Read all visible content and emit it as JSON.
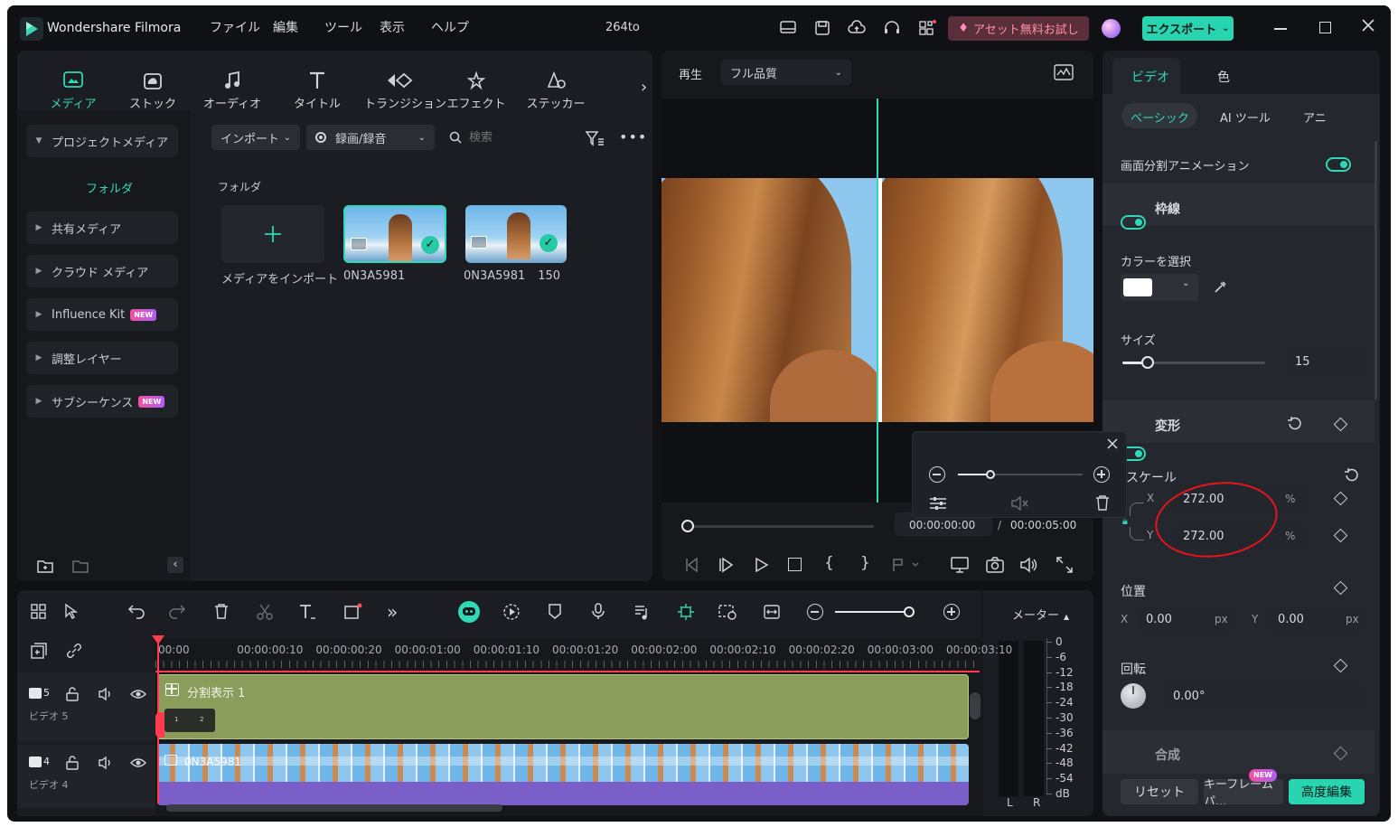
{
  "app": {
    "logo_text": "Wondershare Filmora",
    "menu": [
      "ファイル",
      "編集",
      "ツール",
      "表示",
      "ヘルプ"
    ],
    "project_name": "264to",
    "asset_promo": "アセット無料お試し",
    "export_label": "エクスポート"
  },
  "media_tabs": [
    {
      "label": "メディア",
      "icon": "media-icon",
      "active": true
    },
    {
      "label": "ストック",
      "icon": "stock-icon"
    },
    {
      "label": "オーディオ",
      "icon": "audio-icon"
    },
    {
      "label": "タイトル",
      "icon": "title-icon"
    },
    {
      "label": "トランジション",
      "icon": "transition-icon"
    },
    {
      "label": "エフェクト",
      "icon": "effect-icon"
    },
    {
      "label": "ステッカー",
      "icon": "sticker-icon"
    }
  ],
  "sidebar": {
    "project_media": "プロジェクトメディア",
    "folder": "フォルダ",
    "items": [
      {
        "label": "共有メディア"
      },
      {
        "label": "クラウド メディア"
      },
      {
        "label": "Influence Kit",
        "badge": "NEW"
      },
      {
        "label": "調整レイヤー"
      },
      {
        "label": "サブシーケンス",
        "badge": "NEW"
      }
    ]
  },
  "media_toolbar": {
    "import": "インポート",
    "record": "録画/録音",
    "search_placeholder": "検索"
  },
  "media_grid": {
    "folder_label": "フォルダ",
    "import_tile": "メディアをインポート",
    "items": [
      {
        "name": "0N3A5981"
      },
      {
        "name": "0N3A5981",
        "suffix": "150"
      }
    ]
  },
  "preview": {
    "play_label": "再生",
    "quality": "フル品質",
    "time_current": "00:00:00:00",
    "time_separator": "/",
    "time_total": "00:00:05:00"
  },
  "right_panel": {
    "tabs": [
      "ビデオ",
      "色"
    ],
    "subtabs": [
      "ベーシック",
      "AI ツール",
      "アニ"
    ],
    "split_anim": "画面分割アニメーション",
    "border": "枠線",
    "color_label": "カラーを選択",
    "color_value": "#ffffff",
    "size_label": "サイズ",
    "size_value": "15",
    "size_fraction": 0.18,
    "transform": "変形",
    "scale": "スケール",
    "scale_x": "272.00",
    "scale_y": "272.00",
    "axis_x": "X",
    "axis_y": "Y",
    "percent": "%",
    "position": "位置",
    "pos_x": "0.00",
    "pos_y": "0.00",
    "px": "px",
    "rotation": "回転",
    "rotation_value": "0.00°",
    "composite": "合成",
    "reset": "リセット",
    "keyframe": "キーフレームパ...",
    "new_badge": "NEW",
    "advanced": "高度編集"
  },
  "timeline": {
    "ruler": [
      "00:00",
      "00:00:00:10",
      "00:00:00:20",
      "00:00:01:00",
      "00:00:01:10",
      "00:00:01:20",
      "00:00:02:00",
      "00:00:02:10",
      "00:00:02:20",
      "00:00:03:00",
      "00:00:03:10"
    ],
    "tracks": [
      {
        "num": "5",
        "label": "ビデオ 5",
        "clip": "分割表示 1"
      },
      {
        "num": "4",
        "label": "ビデオ 4",
        "clip": "0N3A5981"
      }
    ],
    "split_cells": [
      "1",
      "2"
    ]
  },
  "meter": {
    "title": "メーター",
    "scale": [
      "0",
      "-6",
      "-12",
      "-18",
      "-24",
      "-30",
      "-36",
      "-42",
      "-48",
      "-54",
      "dB"
    ],
    "channels": [
      "L",
      "R"
    ]
  },
  "colors": {
    "accent": "#2fd8b6",
    "export_bg": "#29d4b1",
    "split_clip": "#8a9d5b",
    "video_clip": "#7b5fc9",
    "annotation": "#e8141c"
  }
}
